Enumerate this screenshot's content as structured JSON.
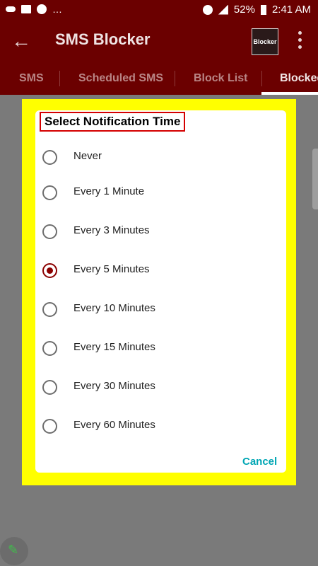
{
  "status_bar": {
    "battery_percent": "52%",
    "time": "2:41 AM"
  },
  "app_bar": {
    "title": "SMS Blocker",
    "logo_text": "Blocker"
  },
  "tabs": [
    {
      "label": "SMS"
    },
    {
      "label": "Scheduled SMS"
    },
    {
      "label": "Block List"
    },
    {
      "label": "Blocked"
    }
  ],
  "dialog": {
    "title": "Select Notification Time",
    "options": [
      {
        "label": "Never",
        "selected": false
      },
      {
        "label": "Every 1 Minute",
        "selected": false
      },
      {
        "label": "Every 3 Minutes",
        "selected": false
      },
      {
        "label": "Every 5 Minutes",
        "selected": true
      },
      {
        "label": "Every 10 Minutes",
        "selected": false
      },
      {
        "label": "Every 15 Minutes",
        "selected": false
      },
      {
        "label": "Every 30 Minutes",
        "selected": false
      },
      {
        "label": "Every 60 Minutes",
        "selected": false
      }
    ],
    "cancel_label": "Cancel"
  },
  "colors": {
    "app_bar": "#6b0000",
    "dialog_frame": "#ffff00",
    "accent": "#8b0000",
    "cancel": "#00a6b4"
  }
}
